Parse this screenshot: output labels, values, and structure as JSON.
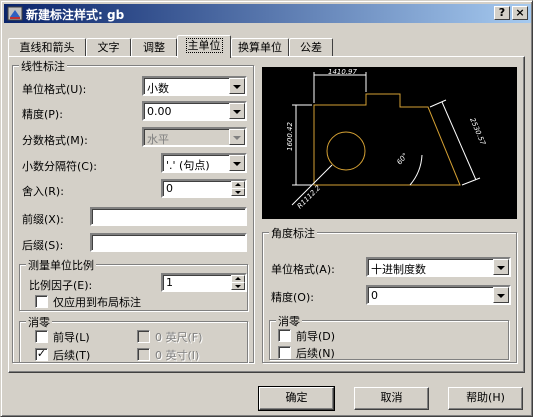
{
  "window": {
    "title": "新建标注样式: gb",
    "help_button": "?",
    "close_button": "×"
  },
  "tabs": [
    {
      "label": "直线和箭头"
    },
    {
      "label": "文字"
    },
    {
      "label": "调整"
    },
    {
      "label": "主单位",
      "active": true
    },
    {
      "label": "换算单位"
    },
    {
      "label": "公差"
    }
  ],
  "linear": {
    "title": "线性标注",
    "unit_format": {
      "label": "单位格式(U):",
      "value": "小数"
    },
    "precision": {
      "label": "精度(P):",
      "value": "0.00"
    },
    "fraction_format": {
      "label": "分数格式(M):",
      "value": "水平"
    },
    "decimal_separator": {
      "label": "小数分隔符(C):",
      "value": "'.' (句点)"
    },
    "round_off": {
      "label": "舍入(R):",
      "value": "0"
    },
    "prefix": {
      "label": "前缀(X):",
      "value": ""
    },
    "suffix": {
      "label": "后缀(S):",
      "value": ""
    }
  },
  "scale": {
    "title": "测量单位比例",
    "factor": {
      "label": "比例因子(E):",
      "value": "1"
    },
    "layout_only": {
      "label": "仅应用到布局标注",
      "checked": false
    }
  },
  "linear_zero": {
    "title": "消零",
    "leading": {
      "label": "前导(L)",
      "checked": false
    },
    "trailing": {
      "label": "后续(T)",
      "checked": true
    },
    "feet": {
      "label": "0 英尺(F)",
      "checked": false
    },
    "inches": {
      "label": "0 英寸(I)",
      "checked": false
    }
  },
  "preview": {
    "dim_top": "1410.97",
    "dim_left": "1600.42",
    "dim_right": "2530.57",
    "dim_angle": "60°",
    "dim_radius": "R1112.2"
  },
  "angular": {
    "title": "角度标注",
    "unit_format": {
      "label": "单位格式(A):",
      "value": "十进制度数"
    },
    "precision": {
      "label": "精度(O):",
      "value": "0"
    }
  },
  "angular_zero": {
    "title": "消零",
    "leading": {
      "label": "前导(D)",
      "checked": false
    },
    "trailing": {
      "label": "后续(N)",
      "checked": false
    }
  },
  "buttons": {
    "ok": "确定",
    "cancel": "取消",
    "help": "帮助(H)"
  },
  "colors": {
    "titlebar_start": "#0a246a",
    "titlebar_end": "#a6caf0",
    "preview_bg": "#000000",
    "preview_geometry": "#d4a033",
    "preview_dims": "#ffffff"
  }
}
